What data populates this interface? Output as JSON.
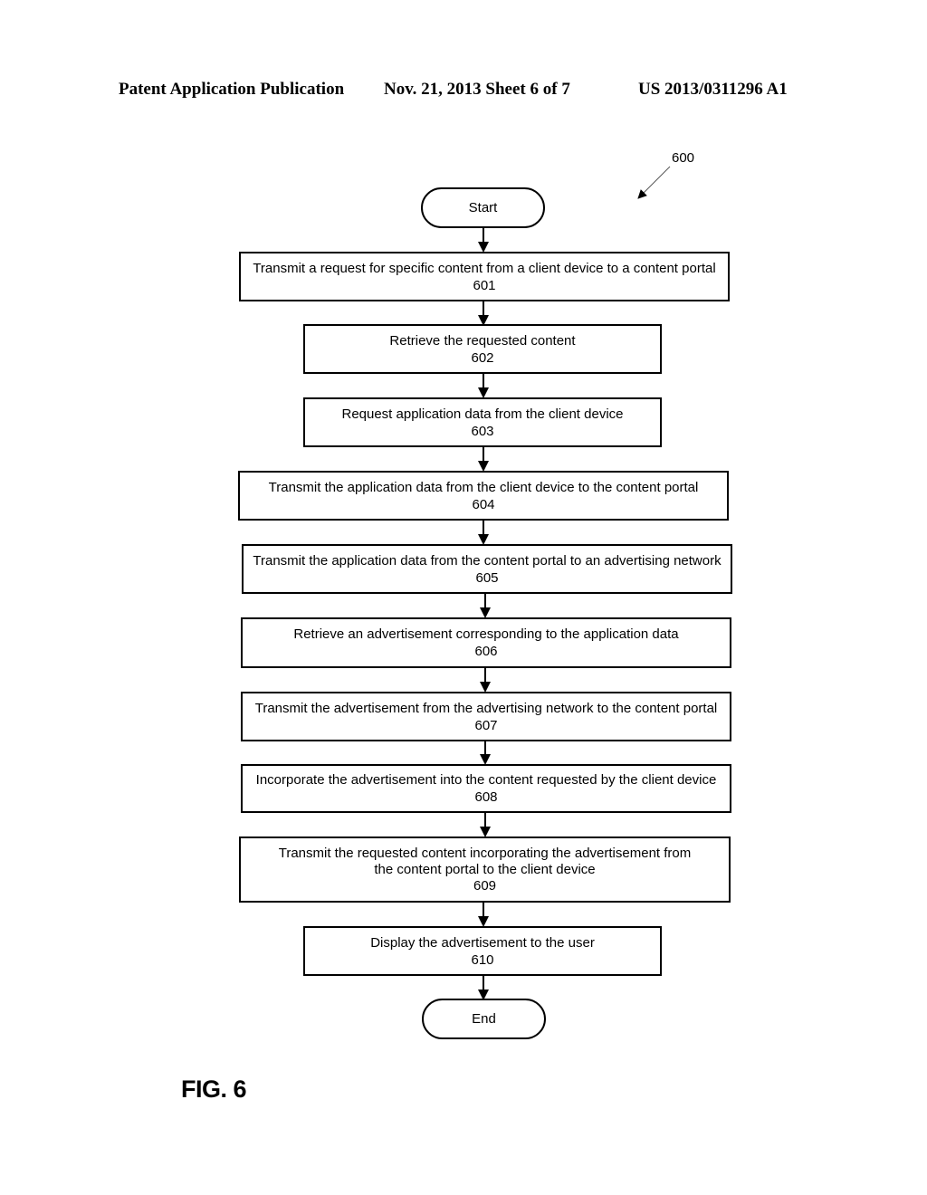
{
  "header": {
    "publication": "Patent Application Publication",
    "date_sheet": "Nov. 21, 2013   Sheet 6 of 7",
    "patent_number": "US 2013/0311296 A1"
  },
  "figure": {
    "reference_numeral": "600",
    "label": "FIG. 6",
    "start_label": "Start",
    "end_label": "End",
    "steps": [
      {
        "text": "Transmit a request for specific content from a client device to a content portal",
        "number": "601"
      },
      {
        "text": "Retrieve the requested content",
        "number": "602"
      },
      {
        "text": "Request application data from the client device",
        "number": "603"
      },
      {
        "text": "Transmit the application data from the client device to the content portal",
        "number": "604"
      },
      {
        "text": "Transmit the application data from the content portal to an advertising network",
        "number": "605"
      },
      {
        "text": "Retrieve an advertisement corresponding to the application data",
        "number": "606"
      },
      {
        "text": "Transmit the advertisement from the advertising network to the content portal",
        "number": "607"
      },
      {
        "text": "Incorporate the advertisement into the content requested by the client device",
        "number": "608"
      },
      {
        "text": "Transmit the requested content incorporating the advertisement from the content portal to the client device",
        "number": "609"
      },
      {
        "text": "Display the advertisement to the user",
        "number": "610"
      }
    ]
  }
}
